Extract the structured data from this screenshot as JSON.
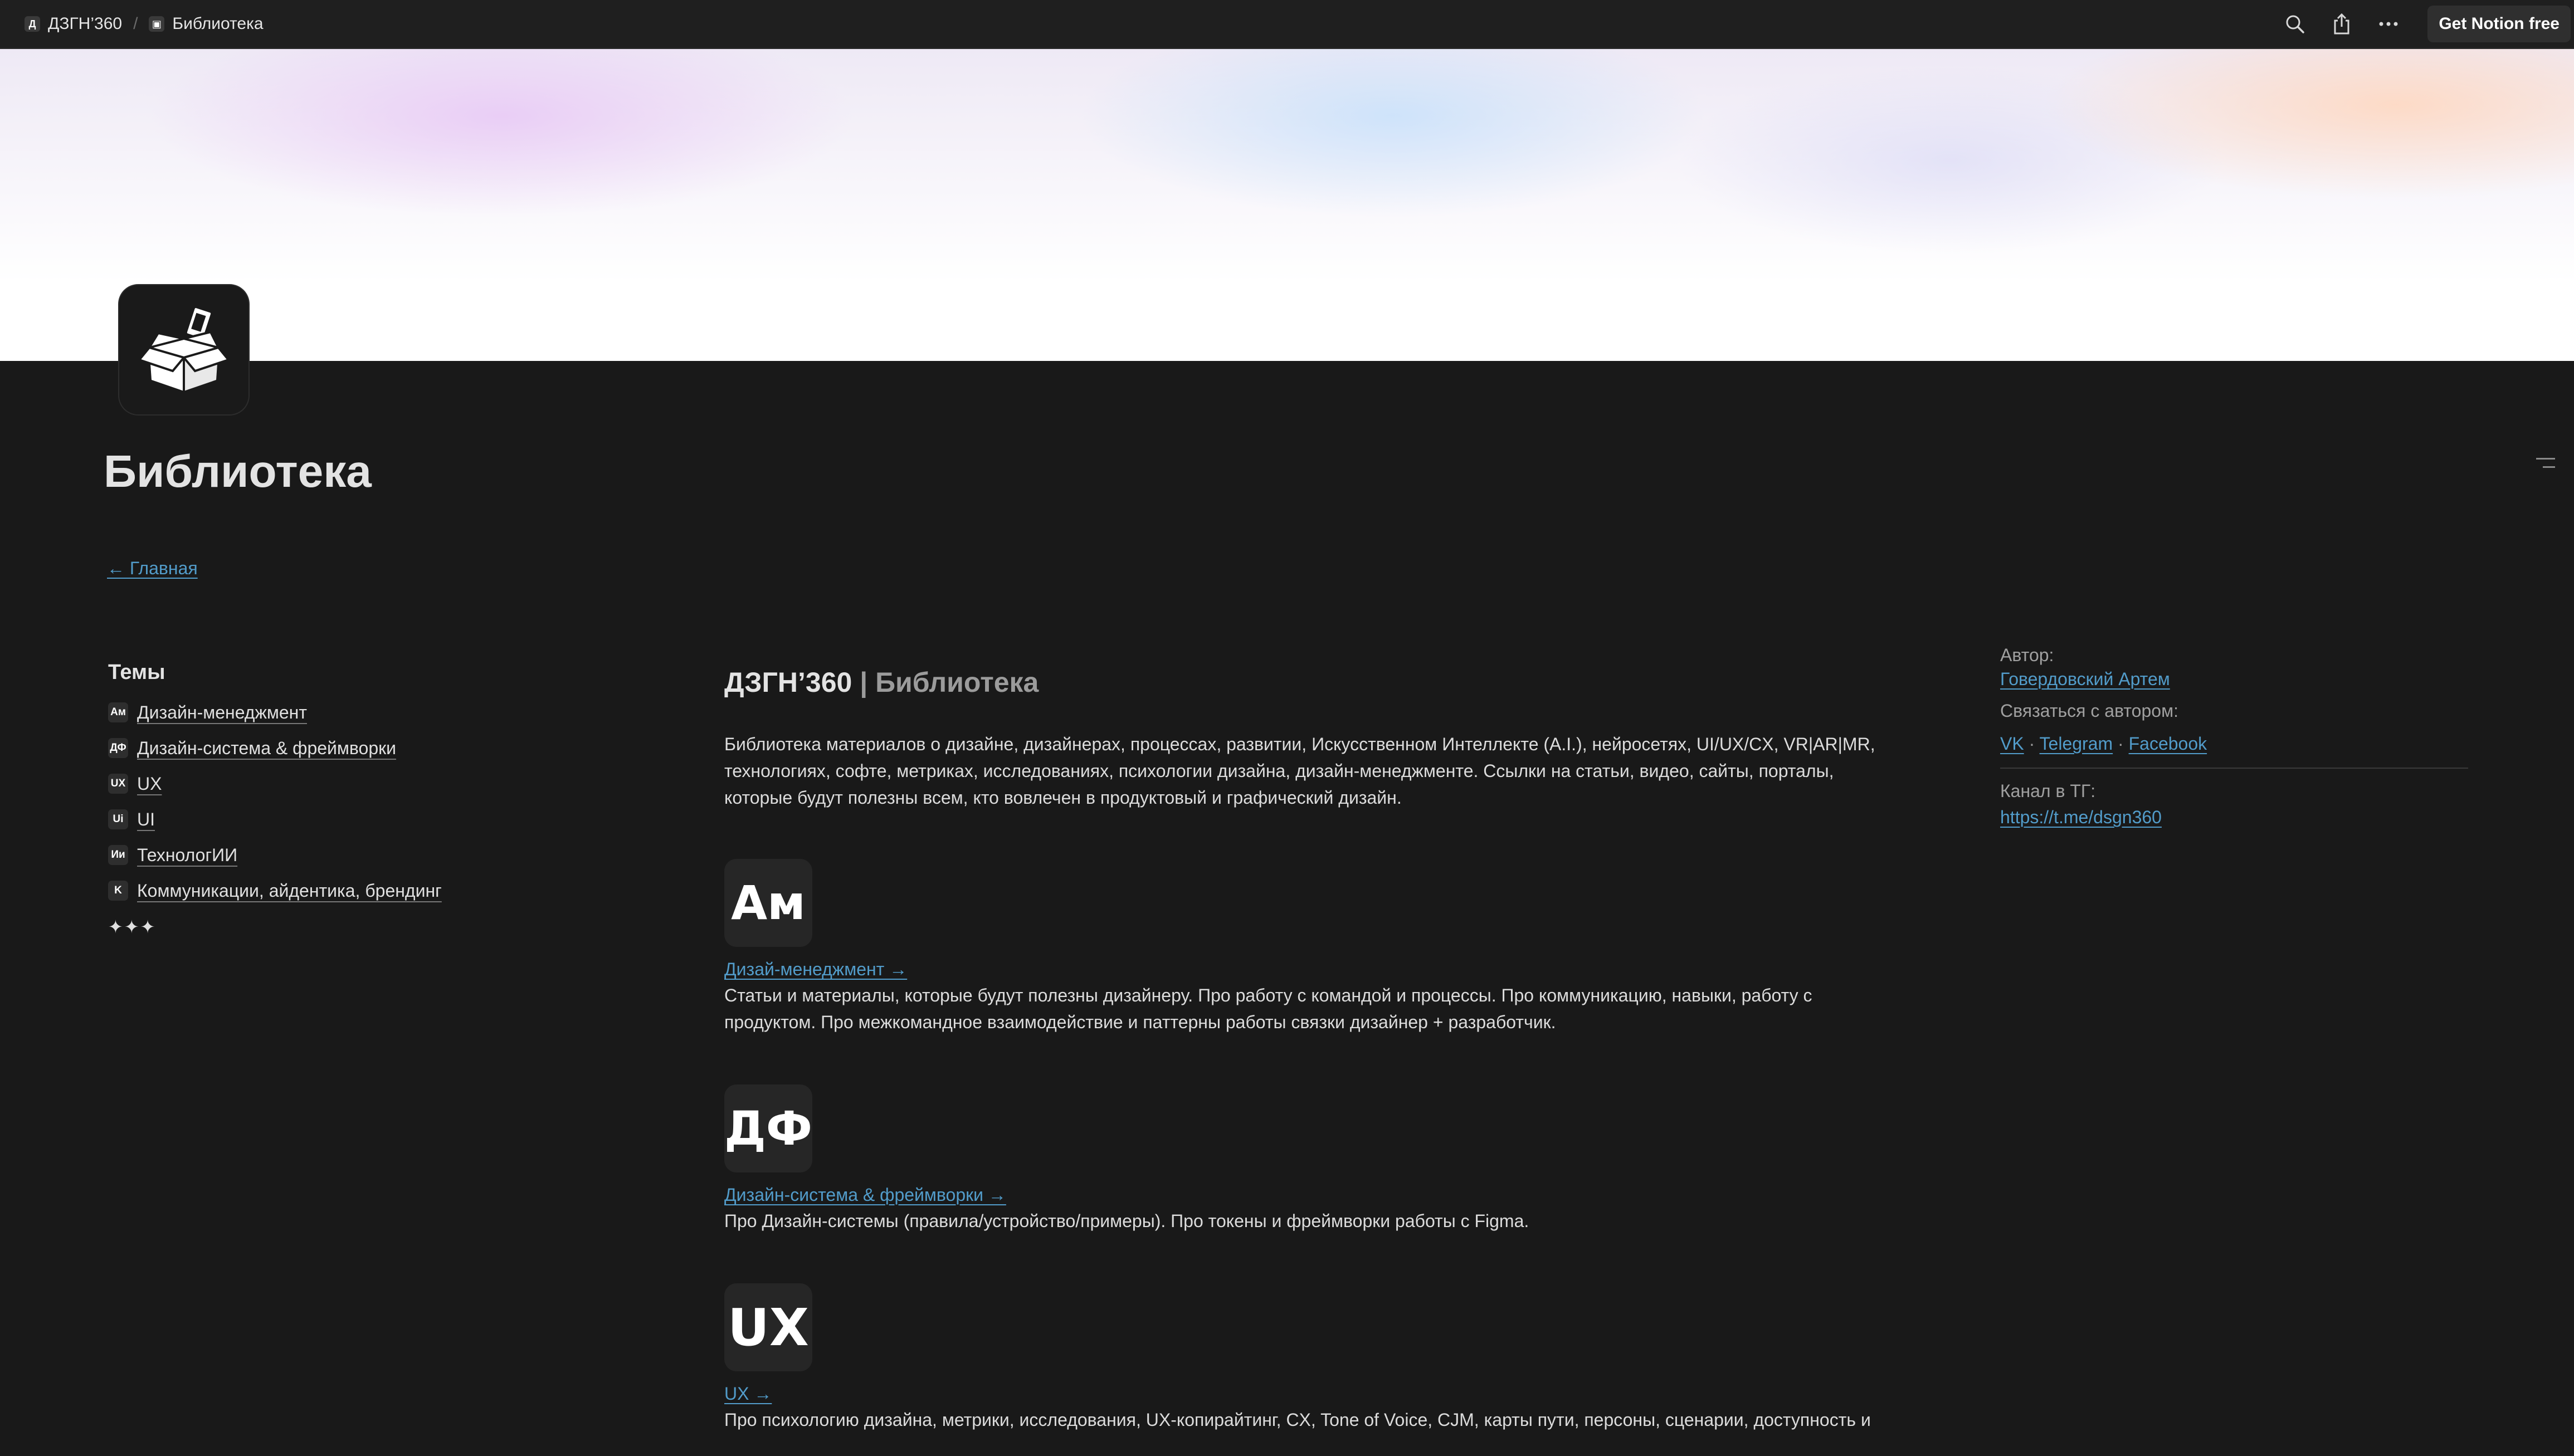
{
  "topbar": {
    "breadcrumbs": [
      {
        "icon": "book-icon",
        "label": "ДЗГН’360"
      },
      {
        "icon": "box-icon",
        "label": "Библиотека"
      }
    ],
    "separator": "/",
    "get_notion_label": "Get Notion free"
  },
  "page": {
    "title": "Библиотека",
    "home_link": "← Главная"
  },
  "topics": {
    "heading": "Темы",
    "items": [
      {
        "icon_text": "Ам",
        "label": "Дизайн-менеджмент"
      },
      {
        "icon_text": "ДФ",
        "label": "Дизайн-система & фреймворки"
      },
      {
        "icon_text": "UX",
        "label": "UX"
      },
      {
        "icon_text": "Ui",
        "label": "UI"
      },
      {
        "icon_text": "Ии",
        "label": "ТехнологИИ"
      },
      {
        "icon_text": "K",
        "label": "Коммуникации, айдентика, брендинг"
      }
    ],
    "sparkles": "✦✦✦"
  },
  "main": {
    "brand_name": "ДЗГН’360",
    "brand_sub": " | Библиотека",
    "intro": "Библиотека материалов о дизайне, дизайнерах, процессах, развитии, Искусственном Интеллекте (A.I.), нейросетях, UI/UX/CX, VR|AR|MR, технологиях, софте, метриках, исследованиях, психологии дизайна, дизайн-менеджменте. Ссылки на статьи, видео, сайты, порталы, которые будут полезны всем, кто вовлечен в продуктовый и графический дизайн.",
    "sections": [
      {
        "icon_text": "Ам",
        "link": "Дизай-менеджмент →",
        "desc": "Статьи и материалы, которые будут полезны дизайнеру. Про работу с командой и процессы. Про коммуникацию, навыки, работу с продуктом. Про межкомандное взаимодействие и паттерны работы связки дизайнер + разработчик."
      },
      {
        "icon_text": "ДФ",
        "link": "Дизайн-система & фреймворки →",
        "desc": "Про Дизайн-системы (правила/устройство/примеры). Про токены и фреймворки работы с Figma."
      },
      {
        "icon_text": "UX",
        "link": "UX →",
        "desc": "Про психологию дизайна, метрики, исследования, UX-копирайтинг, CX, Tone of Voice, CJM, карты пути, персоны, сценарии, доступность и"
      }
    ]
  },
  "sidebar_right": {
    "author_label": "Автор:",
    "author_name": "Говердовский Артем",
    "contact_label": "Связаться с автором:",
    "contacts": [
      "VK",
      "Telegram",
      "Facebook"
    ],
    "contact_separator": " · ",
    "channel_label": "Канал в ТГ:",
    "channel_url": "https://t.me/dsgn360"
  }
}
